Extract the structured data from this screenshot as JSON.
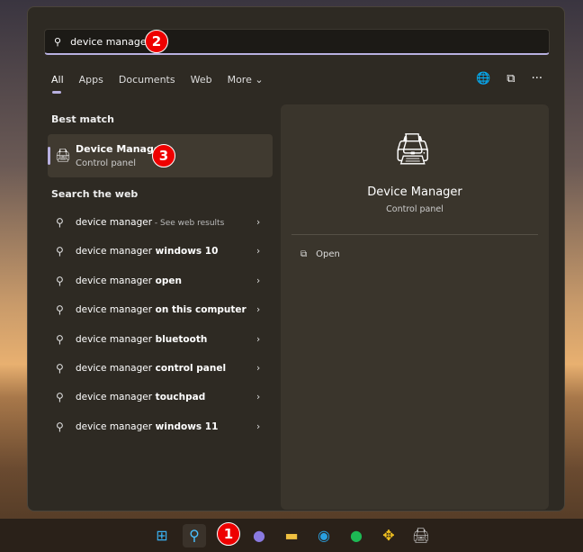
{
  "search": {
    "value": "device manager",
    "badge": "2"
  },
  "tabs": [
    {
      "label": "All"
    },
    {
      "label": "Apps"
    },
    {
      "label": "Documents"
    },
    {
      "label": "Web"
    },
    {
      "label": "More ⌄"
    }
  ],
  "toolbar_icons": [
    "globe-icon",
    "share-icon",
    "more-icon"
  ],
  "best_match": {
    "heading": "Best match",
    "title": "Device Manager",
    "subtitle": "Control panel",
    "badge": "3"
  },
  "web": {
    "heading": "Search the web",
    "items": [
      {
        "prefix": "device manager",
        "bold": "",
        "sub": " - See web results"
      },
      {
        "prefix": "device manager",
        "bold": " windows 10",
        "sub": ""
      },
      {
        "prefix": "device manager",
        "bold": " open",
        "sub": ""
      },
      {
        "prefix": "device manager",
        "bold": " on this computer",
        "sub": ""
      },
      {
        "prefix": "device manager",
        "bold": " bluetooth",
        "sub": ""
      },
      {
        "prefix": "device manager",
        "bold": " control panel",
        "sub": ""
      },
      {
        "prefix": "device manager",
        "bold": " touchpad",
        "sub": ""
      },
      {
        "prefix": "device manager",
        "bold": " windows 11",
        "sub": ""
      }
    ]
  },
  "preview": {
    "title": "Device Manager",
    "subtitle": "Control panel",
    "action": "Open"
  },
  "taskbar": {
    "badge": "1",
    "icons": [
      "windows-start-icon",
      "search-icon",
      "teams-chat-icon",
      "file-explorer-icon",
      "edge-icon",
      "spotify-icon",
      "network-icon",
      "device-manager-icon"
    ]
  },
  "colors": {
    "accent": "#b8b0e0",
    "badge": "#ee0000"
  }
}
